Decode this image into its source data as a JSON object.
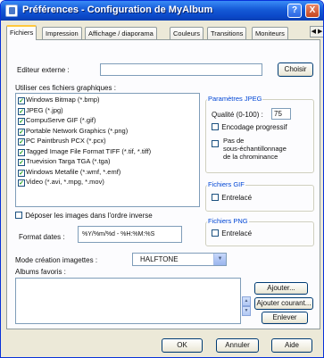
{
  "window": {
    "title": "Préférences - Configuration de MyAlbum",
    "help_glyph": "?",
    "close_glyph": "X"
  },
  "tabs": [
    {
      "label": "Fichiers",
      "active": true
    },
    {
      "label": "Impression"
    },
    {
      "label": "Affichage / diaporama"
    },
    {
      "label": "Couleurs"
    },
    {
      "label": "Transitions"
    },
    {
      "label": "Moniteurs"
    }
  ],
  "tab_scroll_glyph": "◀ ▶",
  "external_editor": {
    "label": "Editeur externe :",
    "value": "",
    "choose_label": "Choisir"
  },
  "graphic_files": {
    "label": "Utiliser ces fichiers graphiques :",
    "items": [
      {
        "label": "Windows Bitmap (*.bmp)",
        "checked": true
      },
      {
        "label": "JPEG (*.jpg)",
        "checked": true
      },
      {
        "label": "CompuServe GIF (*.gif)",
        "checked": true
      },
      {
        "label": "Portable Network Graphics (*.png)",
        "checked": true
      },
      {
        "label": "PC Paintbrush PCX (*.pcx)",
        "checked": true
      },
      {
        "label": "Tagged Image File Format TIFF (*.tif, *.tiff)",
        "checked": true
      },
      {
        "label": "Truevision Targa TGA (*.tga)",
        "checked": true
      },
      {
        "label": "Windows Metafile (*.wmf, *.emf)",
        "checked": true
      },
      {
        "label": "Video (*.avi, *.mpg, *.mov)",
        "checked": true
      }
    ]
  },
  "jpeg_group": {
    "title": "Paramètres JPEG",
    "quality_label": "Qualité (0-100) :",
    "quality_value": "75",
    "progressive_label": "Encodage progressif",
    "progressive_checked": false,
    "no_subsampling_line1": "Pas de",
    "no_subsampling_line2": "sous-échantillonnage",
    "no_subsampling_line3": "de la chrominance",
    "no_subsampling_checked": false
  },
  "gif_group": {
    "title": "Fichiers GIF",
    "interlace_label": "Entrelacé",
    "checked": false
  },
  "png_group": {
    "title": "Fichiers PNG",
    "interlace_label": "Entrelacé",
    "checked": false
  },
  "reverse_order": {
    "label": "Déposer les images dans l'ordre inverse",
    "checked": false
  },
  "date_format": {
    "label": "Format dates :",
    "value": "%Y/%m/%d - %H:%M:%S"
  },
  "thumbnail_mode": {
    "label": "Mode création imagettes :",
    "value": "HALFTONE"
  },
  "favorite_albums": {
    "label": "Albums favoris :",
    "add_label": "Ajouter...",
    "add_current_label": "Ajouter courant...",
    "remove_label": "Enlever"
  },
  "footer": {
    "ok_label": "OK",
    "cancel_label": "Annuler",
    "help_label": "Aide"
  },
  "colors": {
    "title_bar": "#0b48c8",
    "group_title": "#0046d5",
    "dialog_bg": "#ece9d8"
  }
}
